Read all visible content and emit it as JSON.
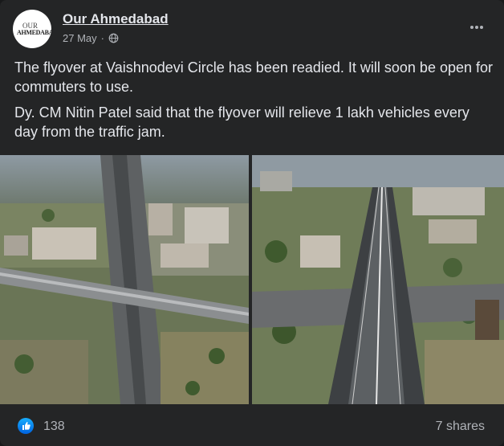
{
  "post": {
    "page_name": "Our Ahmedabad",
    "date": "27 May",
    "separator": "·",
    "privacy_icon": "globe-icon",
    "avatar_logo": {
      "line1": "OUR",
      "line2": "AHMEDABAD"
    },
    "paragraphs": [
      "The flyover at Vaishnodevi Circle has been readied. It will soon be open for commuters to use.",
      "Dy. CM Nitin Patel said that the flyover will relieve 1 lakh vehicles every day from the traffic jam."
    ]
  },
  "reactions": {
    "icon": "like-icon",
    "count": "138",
    "shares": "7 shares"
  },
  "colors": {
    "background": "#18191a",
    "card": "#242526",
    "text_primary": "#e4e6eb",
    "text_secondary": "#b0b3b8",
    "like_blue": "#1877f2"
  }
}
